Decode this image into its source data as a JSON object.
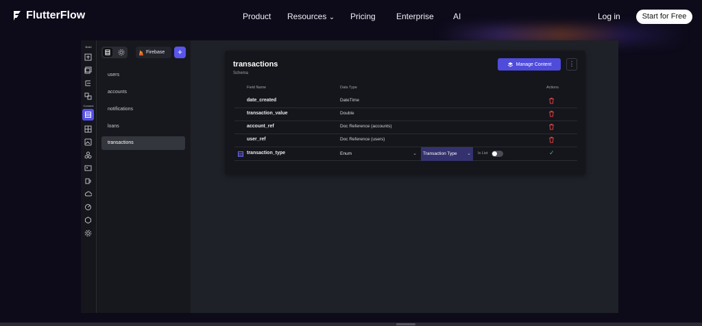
{
  "site": {
    "brand": "FlutterFlow",
    "nav": [
      {
        "label": "Product"
      },
      {
        "label": "Resources"
      },
      {
        "label": "Pricing"
      },
      {
        "label": "Enterprise"
      },
      {
        "label": "AI"
      }
    ],
    "login": "Log in",
    "cta": "Start for Free"
  },
  "app": {
    "rail": {
      "build_label": "Build",
      "connect_label": "Connect",
      "icons": [
        "page-icon",
        "widgets-icon",
        "tree-icon",
        "components-icon",
        "firestore-icon",
        "schema-icon",
        "media-icon",
        "integrations-icon",
        "assets-icon",
        "api-icon",
        "cloud-icon",
        "analytics-icon",
        "agent-icon",
        "settings-icon"
      ]
    },
    "sidebar": {
      "backend_label": "Firebase",
      "add_label": "+",
      "collections": [
        {
          "label": "users",
          "active": false
        },
        {
          "label": "accounts",
          "active": false
        },
        {
          "label": "notifications",
          "active": false
        },
        {
          "label": "loans",
          "active": false
        },
        {
          "label": "transactions",
          "active": true
        }
      ]
    },
    "panel": {
      "title": "transactions",
      "subtitle": "Schema",
      "manage_label": "Manage Content",
      "more_label": "⋮",
      "columns": {
        "field": "Field Name",
        "type": "Data Type",
        "actions": "Actions"
      },
      "fields": [
        {
          "name": "date_created",
          "type": "DateTime"
        },
        {
          "name": "transaction_value",
          "type": "Double"
        },
        {
          "name": "account_ref",
          "type": "Doc Reference (accounts)"
        },
        {
          "name": "user_ref",
          "type": "Doc Reference (users)"
        }
      ],
      "editing": {
        "name": "transaction_type",
        "type": "Enum",
        "enum_value": "Transaction Type",
        "is_list_label": "Is List",
        "is_list": false,
        "confirm": "✓"
      }
    }
  },
  "colors": {
    "accent": "#5a55ea",
    "danger": "#d94040",
    "success": "#38c172"
  }
}
